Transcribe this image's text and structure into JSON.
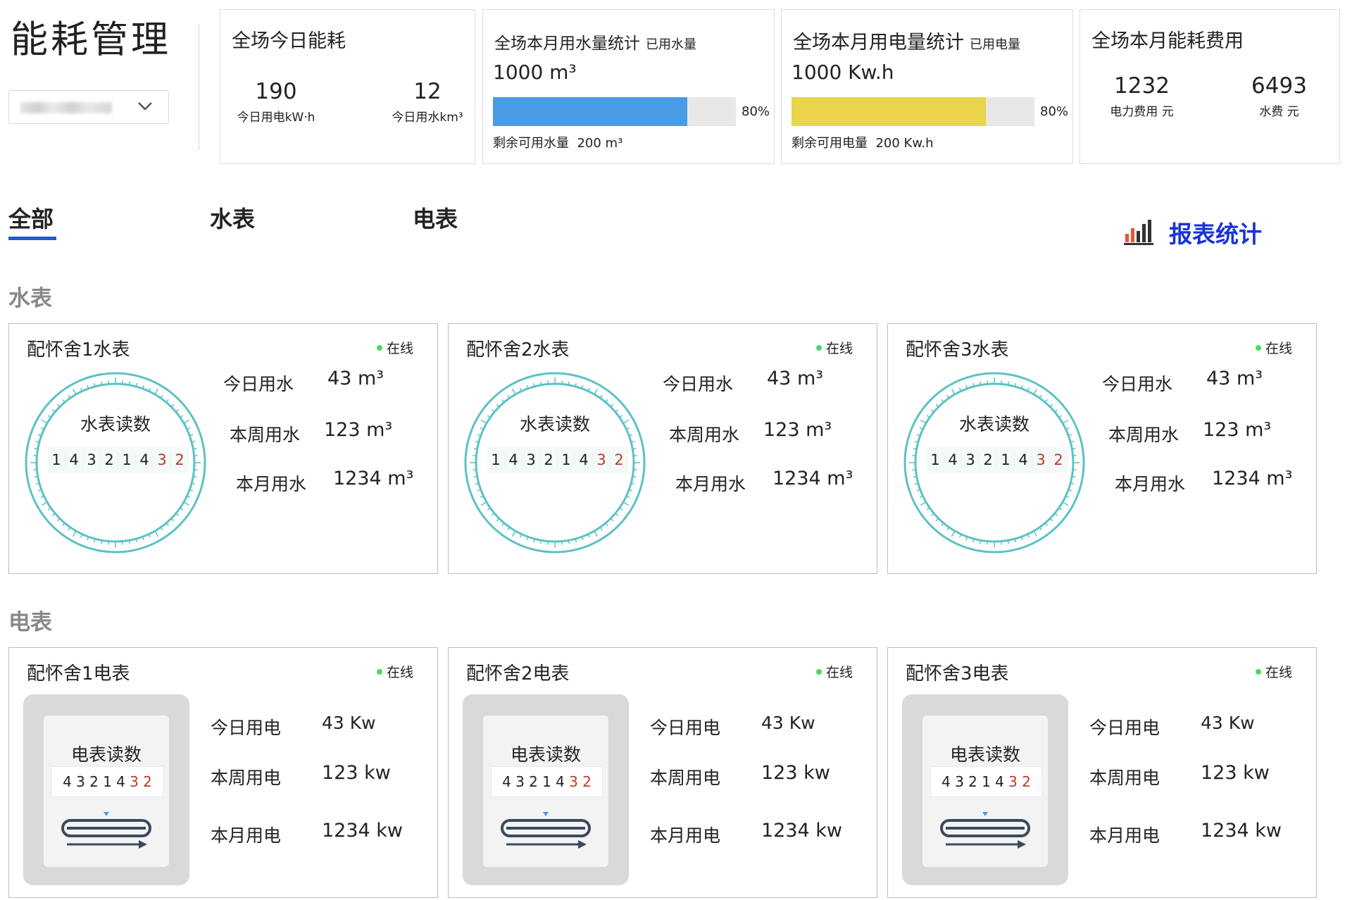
{
  "header": {
    "title": "能耗管理"
  },
  "cards": {
    "today": {
      "title": "全场今日能耗",
      "elec_value": "190",
      "elec_label": "今日用电kW·h",
      "water_value": "12",
      "water_label": "今日用水km³"
    },
    "water": {
      "title": "全场本月用水量统计",
      "subtitle": "已用水量",
      "value": "1000 m³",
      "percent": 80,
      "percent_label": "80%",
      "bar_color": "#4a9be6",
      "remain_label": "剩余可用水量",
      "remain_value": "200 m³"
    },
    "electric": {
      "title": "全场本月用电量统计",
      "subtitle": "已用电量",
      "value": "1000 Kw.h",
      "percent": 80,
      "percent_label": "80%",
      "bar_color": "#e9d44b",
      "remain_label": "剩余可用电量",
      "remain_value": "200 Kw.h"
    },
    "cost": {
      "title": "全场本月能耗费用",
      "elec_value": "1232",
      "elec_label": "电力费用 元",
      "water_value": "6493",
      "water_label": "水费 元"
    }
  },
  "tabs": [
    {
      "label": "全部",
      "active": true
    },
    {
      "label": "水表",
      "active": false
    },
    {
      "label": "电表",
      "active": false
    }
  ],
  "report_link": {
    "label": "报表统计",
    "icon": "bar-chart-icon"
  },
  "sections": {
    "water": "水表",
    "electric": "电表"
  },
  "water_meters": [
    {
      "name": "配怀舍1水表",
      "status": "在线",
      "dial_title": "水表读数",
      "today_label": "今日用水",
      "today_value": "43 m³",
      "week_label": "本周用水",
      "week_value": "123 m³",
      "month_label": "本月用水",
      "month_value": "1234 m³",
      "digits": [
        "1",
        "4",
        "3",
        "2",
        "1",
        "4",
        "3",
        "2"
      ]
    },
    {
      "name": "配怀舍2水表",
      "status": "在线",
      "dial_title": "水表读数",
      "today_label": "今日用水",
      "today_value": "43 m³",
      "week_label": "本周用水",
      "week_value": "123 m³",
      "month_label": "本月用水",
      "month_value": "1234 m³",
      "digits": [
        "1",
        "4",
        "3",
        "2",
        "1",
        "4",
        "3",
        "2"
      ]
    },
    {
      "name": "配怀舍3水表",
      "status": "在线",
      "dial_title": "水表读数",
      "today_label": "今日用水",
      "today_value": "43 m³",
      "week_label": "本周用水",
      "week_value": "123 m³",
      "month_label": "本月用水",
      "month_value": "1234 m³",
      "digits": [
        "1",
        "4",
        "3",
        "2",
        "1",
        "4",
        "3",
        "2"
      ]
    }
  ],
  "electric_meters": [
    {
      "name": "配怀舍1电表",
      "status": "在线",
      "dial_title": "电表读数",
      "today_label": "今日用电",
      "today_value": "43 Kw",
      "week_label": "本周用电",
      "week_value": "123 kw",
      "month_label": "本月用电",
      "month_value": "1234 kw",
      "digits": [
        "4",
        "3",
        "2",
        "1",
        "4",
        "3",
        "2"
      ]
    },
    {
      "name": "配怀舍2电表",
      "status": "在线",
      "dial_title": "电表读数",
      "today_label": "今日用电",
      "today_value": "43 Kw",
      "week_label": "本周用电",
      "week_value": "123 kw",
      "month_label": "本月用电",
      "month_value": "1234 kw",
      "digits": [
        "4",
        "3",
        "2",
        "1",
        "4",
        "3",
        "2"
      ]
    },
    {
      "name": "配怀舍3电表",
      "status": "在线",
      "dial_title": "电表读数",
      "today_label": "今日用电",
      "today_value": "43 Kw",
      "week_label": "本周用电",
      "week_value": "123 kw",
      "month_label": "本月用电",
      "month_value": "1234 kw",
      "digits": [
        "4",
        "3",
        "2",
        "1",
        "4",
        "3",
        "2"
      ]
    }
  ],
  "colors": {
    "accent_blue": "#1833d8",
    "tab_underline": "#1f5bcc",
    "online_dot": "#4cd964",
    "dial_ring": "#5cc2c3",
    "digit_red": "#c0392b"
  }
}
